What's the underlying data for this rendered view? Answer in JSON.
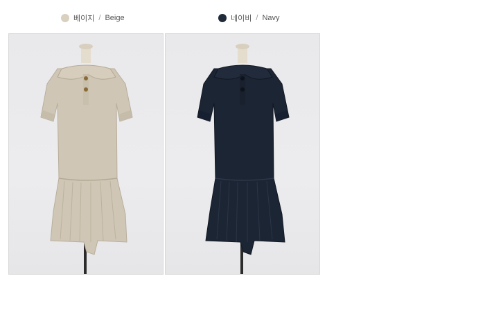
{
  "colors": {
    "beige_swatch": "#d9d0bf",
    "navy_swatch": "#1f2a3b",
    "beige_fabric": "#cfc6b5",
    "navy_fabric": "#1c2534"
  },
  "options": [
    {
      "korean": "베이지",
      "english": "Beige"
    },
    {
      "korean": "네이비",
      "english": "Navy"
    }
  ]
}
